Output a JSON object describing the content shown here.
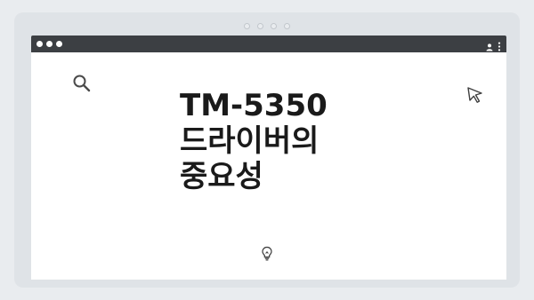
{
  "window": {
    "title_lines": [
      "TM-5350",
      "드라이버의",
      "중요성"
    ]
  },
  "icons": {
    "search": "search-icon",
    "cursor": "cursor-arrow-icon",
    "lightbulb": "lightbulb-icon",
    "user": "user-icon",
    "menu": "kebab-menu-icon"
  },
  "colors": {
    "titlebar": "#3c3f43",
    "frame": "#dfe3e7",
    "content_bg": "#ffffff",
    "text": "#1a1a1a"
  }
}
